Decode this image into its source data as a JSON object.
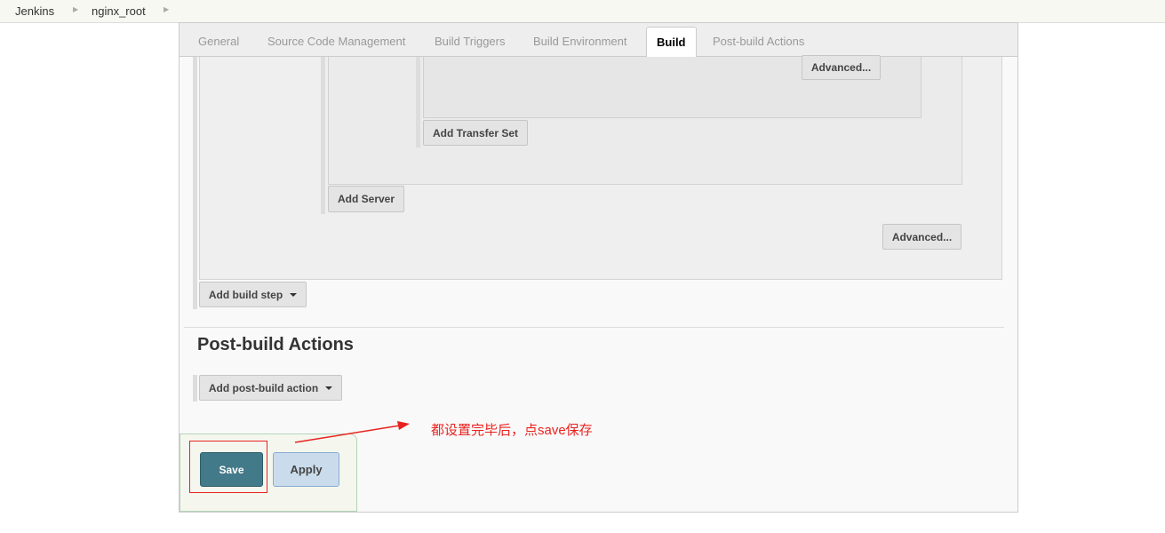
{
  "breadcrumb": [
    "Jenkins",
    "nginx_root"
  ],
  "tabs": [
    {
      "label": "General"
    },
    {
      "label": "Source Code Management"
    },
    {
      "label": "Build Triggers"
    },
    {
      "label": "Build Environment"
    },
    {
      "label": "Build",
      "active": true
    },
    {
      "label": "Post-build Actions"
    }
  ],
  "build": {
    "advanced_transfer": "Advanced...",
    "add_transfer_set": "Add Transfer Set",
    "add_server": "Add Server",
    "advanced": "Advanced...",
    "add_build_step": "Add build step"
  },
  "post_build": {
    "title": "Post-build Actions",
    "add_action": "Add post-build action"
  },
  "actions": {
    "save": "Save",
    "apply": "Apply"
  },
  "annotation": {
    "text": "都设置完毕后，点save保存",
    "color": "#e8231f"
  }
}
